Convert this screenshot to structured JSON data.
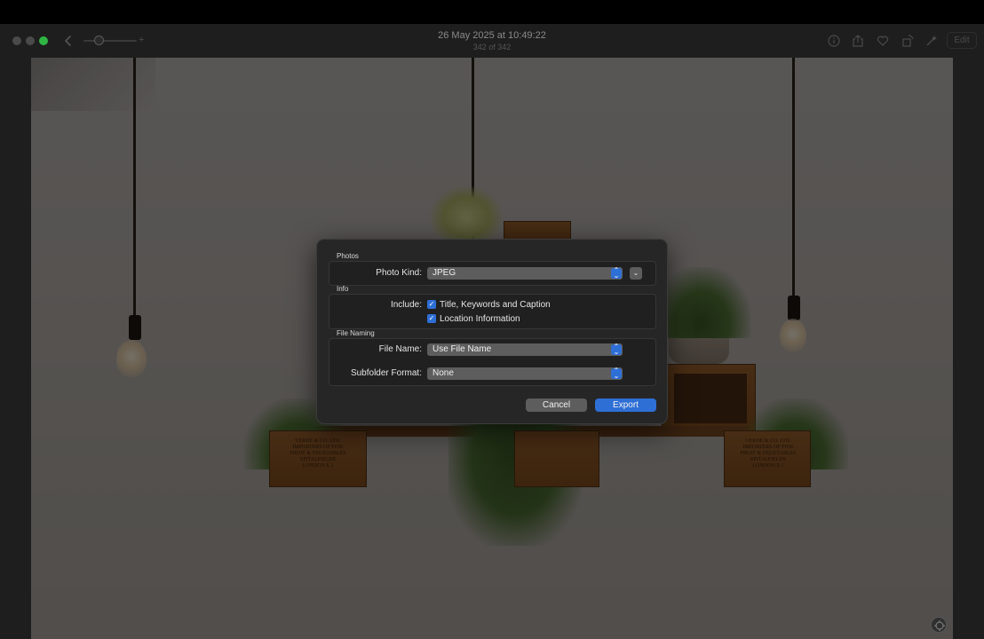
{
  "window": {
    "title": "26 May 2025 at 10:49:22",
    "subtitle": "342 of 342",
    "edit_label": "Edit",
    "toolbar_icons": [
      "info-icon",
      "share-icon",
      "heart-icon",
      "rotate-icon",
      "enhance-icon"
    ]
  },
  "dialog": {
    "photos_section": {
      "title": "Photos",
      "photo_kind_label": "Photo Kind:",
      "photo_kind_value": "JPEG"
    },
    "info_section": {
      "title": "Info",
      "include_label": "Include:",
      "options": [
        {
          "label": "Title, Keywords and Caption",
          "checked": true
        },
        {
          "label": "Location Information",
          "checked": true
        }
      ]
    },
    "naming_section": {
      "title": "File Naming",
      "file_name_label": "File Name:",
      "file_name_value": "Use File Name",
      "subfolder_label": "Subfolder Format:",
      "subfolder_value": "None"
    },
    "cancel_label": "Cancel",
    "export_label": "Export"
  },
  "glyphs": {
    "check": "✓",
    "chevron_down": "⌄",
    "updown": "⌃⌄",
    "back": "‹",
    "plus": "+"
  },
  "colors": {
    "accent": "#2e6fd6",
    "traffic_max": "#2fb544"
  }
}
